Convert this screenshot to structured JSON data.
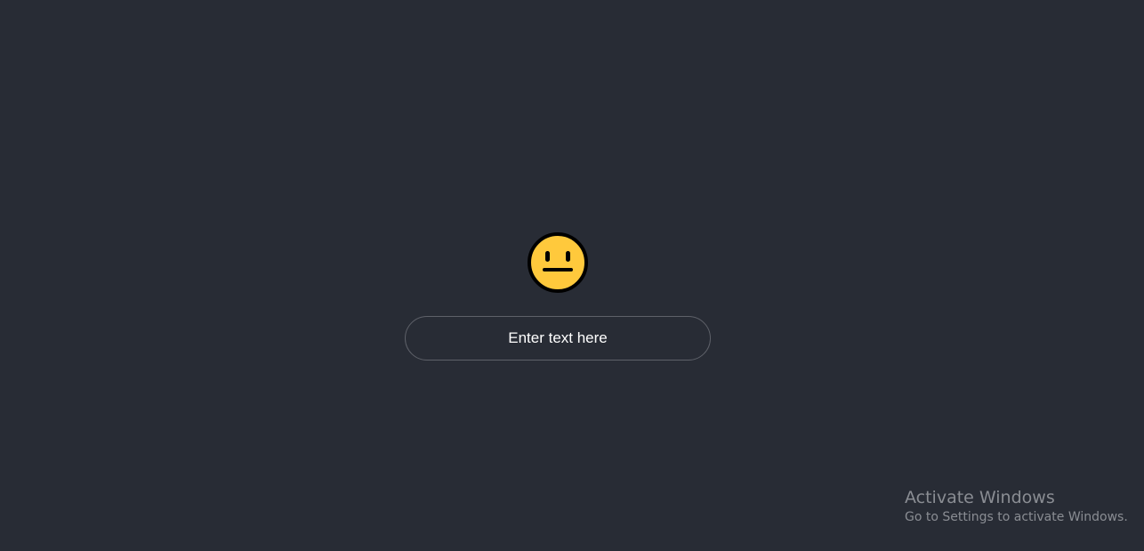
{
  "mood": {
    "icon": "neutral-face-icon",
    "face_color": "#ffc93c",
    "outline_color": "#000000"
  },
  "input": {
    "value": "",
    "placeholder": "Enter text here"
  },
  "watermark": {
    "title": "Activate Windows",
    "subtitle": "Go to Settings to activate Windows."
  },
  "colors": {
    "background": "#282c35",
    "input_border": "#5e6169",
    "text": "#ffffff",
    "watermark_text": "#8a8d93"
  }
}
